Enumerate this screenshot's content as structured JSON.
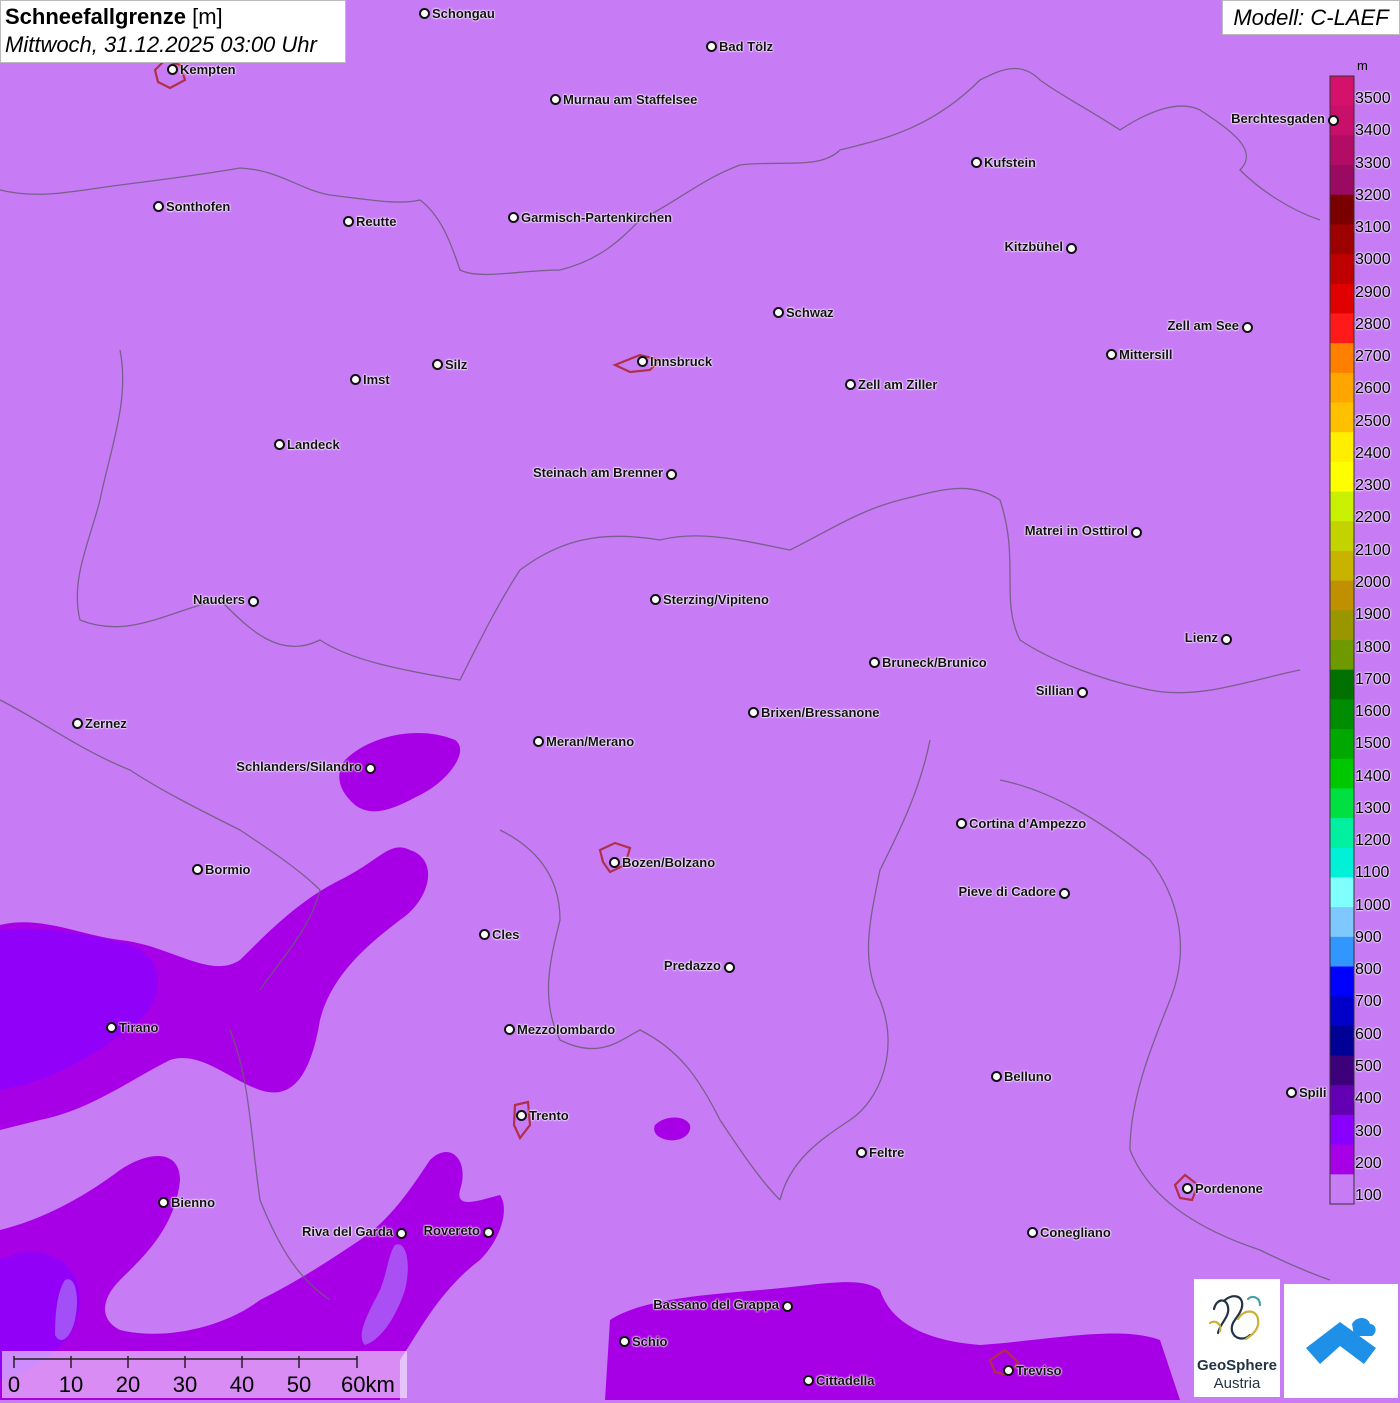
{
  "title": {
    "variable": "Schneefallgrenze",
    "unit": "[m]",
    "datetime": "Mittwoch, 31.12.2025 03:00 Uhr"
  },
  "model": "Modell: C-LAEF",
  "legend": {
    "unit": "m",
    "labels": [
      "3500",
      "3400",
      "3300",
      "3200",
      "3100",
      "3000",
      "2900",
      "2800",
      "2700",
      "2600",
      "2500",
      "2400",
      "2300",
      "2200",
      "2100",
      "2000",
      "1900",
      "1800",
      "1700",
      "1600",
      "1500",
      "1400",
      "1300",
      "1200",
      "1100",
      "1000",
      "900",
      "800",
      "700",
      "600",
      "500",
      "400",
      "300",
      "200",
      "100"
    ],
    "colors": [
      "#d4126b",
      "#c80f6a",
      "#b30c67",
      "#9a0a63",
      "#7a0000",
      "#9c0000",
      "#be0000",
      "#e00000",
      "#ff1a1a",
      "#ff7f00",
      "#ffa500",
      "#ffc000",
      "#ffee00",
      "#ffff00",
      "#c8f000",
      "#c4d200",
      "#c8b400",
      "#c09000",
      "#9a9600",
      "#6e9a00",
      "#007000",
      "#008c00",
      "#00a800",
      "#00c800",
      "#00e040",
      "#00f0a0",
      "#00f0d8",
      "#80ffff",
      "#7fc8ff",
      "#3296ff",
      "#0000ff",
      "#0000c8",
      "#000096",
      "#3c007a",
      "#6400b4",
      "#8a00ff",
      "#a800e6",
      "#c77cf6"
    ]
  },
  "cities": [
    {
      "name": "Schongau",
      "label_side": "right"
    },
    {
      "name": "Bad Tölz",
      "label_side": "right"
    },
    {
      "name": "Kempten",
      "label_side": "right"
    },
    {
      "name": "Murnau am Staffelsee",
      "label_side": "right"
    },
    {
      "name": "Berchtesgaden",
      "label_side": "left"
    },
    {
      "name": "Kufstein",
      "label_side": "right"
    },
    {
      "name": "Sonthofen",
      "label_side": "right"
    },
    {
      "name": "Reutte",
      "label_side": "right"
    },
    {
      "name": "Garmisch-Partenkirchen",
      "label_side": "right"
    },
    {
      "name": "Kitzbühel",
      "label_side": "left"
    },
    {
      "name": "Schwaz",
      "label_side": "right"
    },
    {
      "name": "Zell am See",
      "label_side": "left"
    },
    {
      "name": "Innsbruck",
      "label_side": "right"
    },
    {
      "name": "Mittersill",
      "label_side": "right"
    },
    {
      "name": "Silz",
      "label_side": "right"
    },
    {
      "name": "Imst",
      "label_side": "right"
    },
    {
      "name": "Zell am Ziller",
      "label_side": "right"
    },
    {
      "name": "Landeck",
      "label_side": "right"
    },
    {
      "name": "Steinach am Brenner",
      "label_side": "left"
    },
    {
      "name": "Matrei in Osttirol",
      "label_side": "left"
    },
    {
      "name": "Nauders",
      "label_side": "left"
    },
    {
      "name": "Sterzing/Vipiteno",
      "label_side": "right"
    },
    {
      "name": "Lienz",
      "label_side": "left"
    },
    {
      "name": "Bruneck/Brunico",
      "label_side": "right"
    },
    {
      "name": "Sillian",
      "label_side": "left"
    },
    {
      "name": "Brixen/Bressanone",
      "label_side": "right"
    },
    {
      "name": "Zernez",
      "label_side": "right"
    },
    {
      "name": "Meran/Merano",
      "label_side": "right"
    },
    {
      "name": "Schlanders/Silandro",
      "label_side": "left"
    },
    {
      "name": "Cortina d'Ampezzo",
      "label_side": "right"
    },
    {
      "name": "Bozen/Bolzano",
      "label_side": "right"
    },
    {
      "name": "Bormio",
      "label_side": "right"
    },
    {
      "name": "Pieve di Cadore",
      "label_side": "left"
    },
    {
      "name": "Cles",
      "label_side": "right"
    },
    {
      "name": "Predazzo",
      "label_side": "left"
    },
    {
      "name": "Tirano",
      "label_side": "right"
    },
    {
      "name": "Mezzolombardo",
      "label_side": "right"
    },
    {
      "name": "Belluno",
      "label_side": "right"
    },
    {
      "name": "Spili",
      "label_side": "right"
    },
    {
      "name": "Trento",
      "label_side": "right"
    },
    {
      "name": "Feltre",
      "label_side": "right"
    },
    {
      "name": "Pordenone",
      "label_side": "right"
    },
    {
      "name": "Bienno",
      "label_side": "right"
    },
    {
      "name": "Riva del Garda",
      "label_side": "left"
    },
    {
      "name": "Rovereto",
      "label_side": "left"
    },
    {
      "name": "Conegliano",
      "label_side": "right"
    },
    {
      "name": "Bassano del Grappa",
      "label_side": "left"
    },
    {
      "name": "Schio",
      "label_side": "right"
    },
    {
      "name": "Treviso",
      "label_side": "right"
    },
    {
      "name": "Cittadella",
      "label_side": "right"
    }
  ],
  "scale": {
    "labels": [
      "0",
      "10",
      "20",
      "30",
      "40",
      "50",
      "60km"
    ]
  },
  "logo": {
    "name_line1": "GeoSphere",
    "name_line2": "Austria"
  },
  "colors": {
    "background": "#c77cf6",
    "band_300": "#a800e6",
    "band_400": "#8a00ff",
    "city_border": "#b0304a"
  }
}
